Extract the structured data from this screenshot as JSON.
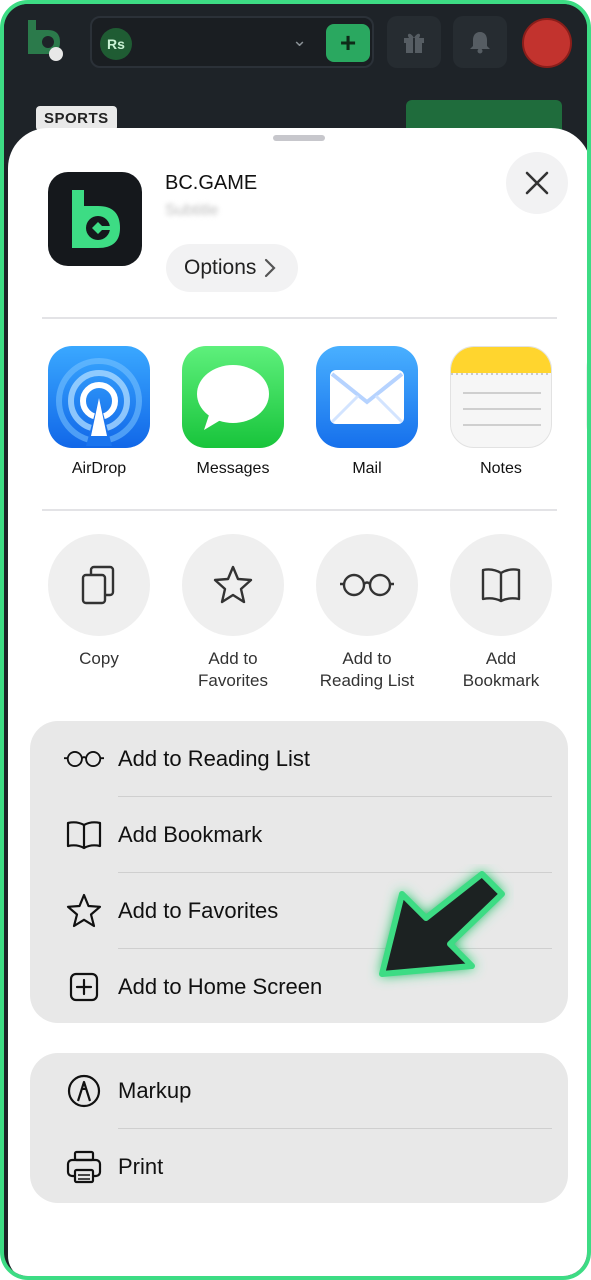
{
  "background_app": {
    "currency_badge": "Rs",
    "add_button": "+",
    "section_chip": "SPORTS"
  },
  "share_sheet": {
    "app_title": "BC.GAME",
    "app_subtitle": "Subtitle",
    "options_label": "Options",
    "apps": [
      {
        "label": "AirDrop",
        "icon": "airdrop-icon"
      },
      {
        "label": "Messages",
        "icon": "messages-icon"
      },
      {
        "label": "Mail",
        "icon": "mail-icon"
      },
      {
        "label": "Notes",
        "icon": "notes-icon"
      }
    ],
    "quick_actions": [
      {
        "line1": "Copy",
        "line2": "",
        "icon": "copy-icon"
      },
      {
        "line1": "Add to",
        "line2": "Favorites",
        "icon": "star-icon"
      },
      {
        "line1": "Add to",
        "line2": "Reading List",
        "icon": "glasses-icon"
      },
      {
        "line1": "Add",
        "line2": "Bookmark",
        "icon": "book-icon"
      }
    ],
    "list_group_1": [
      {
        "label": "Add to Reading List",
        "icon": "glasses-icon"
      },
      {
        "label": "Add Bookmark",
        "icon": "book-icon"
      },
      {
        "label": "Add to Favorites",
        "icon": "star-icon"
      },
      {
        "label": "Add to Home Screen",
        "icon": "plus-square-icon"
      }
    ],
    "list_group_2": [
      {
        "label": "Markup",
        "icon": "markup-icon"
      },
      {
        "label": "Print",
        "icon": "printer-icon"
      }
    ]
  },
  "colors": {
    "frame_border": "#3ddc84",
    "brand_green": "#3ddc84",
    "pointer_arrow": "#1e2124"
  }
}
